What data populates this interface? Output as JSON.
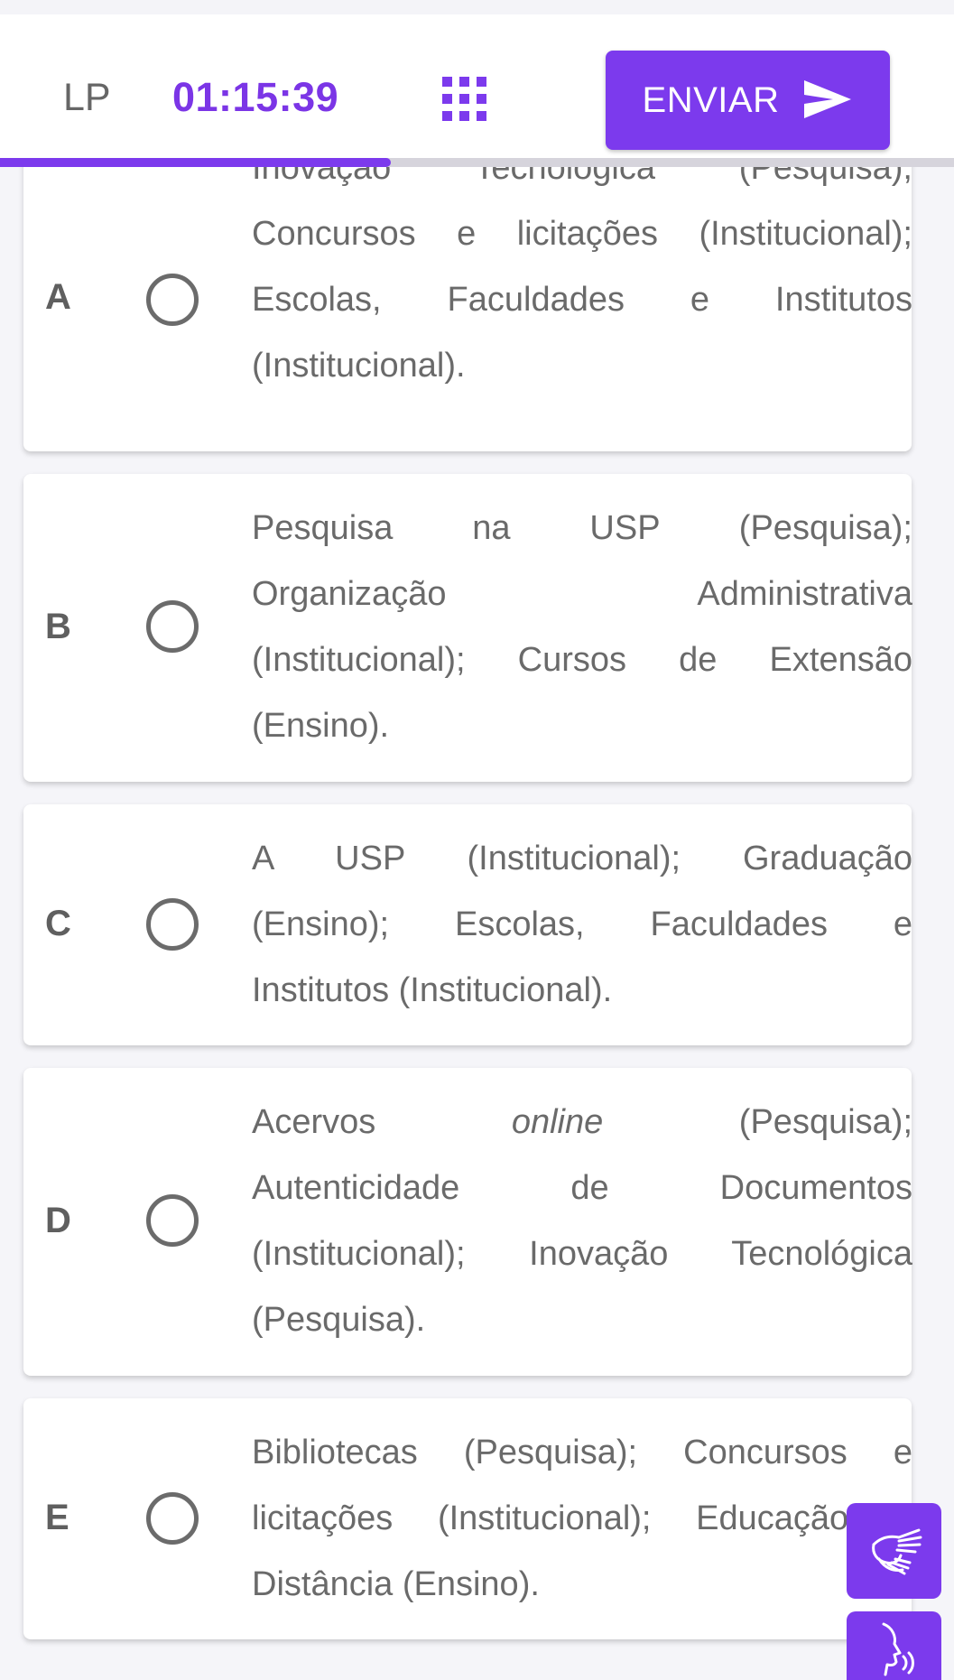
{
  "header": {
    "subject": "LP",
    "timer": "01:15:39",
    "grid_icon": "question-grid-icon",
    "send_label": "ENVIAR",
    "send_icon": "send-arrow-icon",
    "progress_fraction": 0.41
  },
  "options": [
    {
      "letter": "A",
      "lines": [
        "Inovação Tecnológica (Pesquisa);",
        "Concursos e licitações (Institucional);",
        "Escolas, Faculdades e Institutos",
        "(Institucional)."
      ]
    },
    {
      "letter": "B",
      "lines": [
        "Pesquisa na USP (Pesquisa);",
        "Organização Administrativa",
        "(Institucional); Cursos de Extensão",
        "(Ensino)."
      ]
    },
    {
      "letter": "C",
      "lines": [
        "A USP (Institucional); Graduação",
        "(Ensino); Escolas, Faculdades e",
        "Institutos (Institucional)."
      ]
    },
    {
      "letter": "D",
      "text_parts": [
        "Acervos ",
        "online",
        " (Pesquisa);"
      ],
      "lines": [
        "",
        "Autenticidade de Documentos",
        "(Institucional); Inovação Tecnológica",
        "(Pesquisa)."
      ]
    },
    {
      "letter": "E",
      "lines": [
        "Bibliotecas (Pesquisa); Concursos e",
        "licitações (Institucional); Educação a",
        "Distância (Ensino)."
      ]
    }
  ],
  "accessibility": {
    "sign_language_icon": "sign-language-hands-icon",
    "audio_icon": "speak-audio-icon"
  },
  "colors": {
    "accent": "#7c3aed",
    "timer": "#7b35e6",
    "text": "#6a6a6a"
  }
}
